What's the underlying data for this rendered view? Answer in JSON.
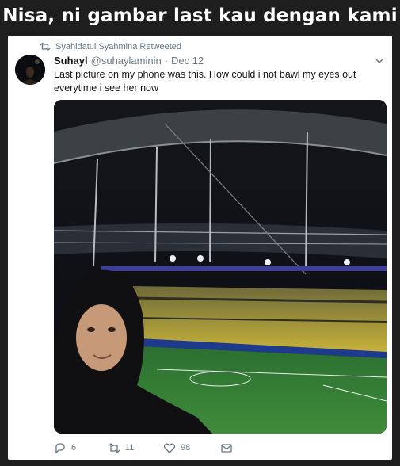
{
  "caption": "Nisa, ni gambar last kau dengan kami",
  "tweet": {
    "retweeted_by": "Syahidatul Syahmina Retweeted",
    "author_name": "Suhayl",
    "author_handle": "@suhaylaminin",
    "separator": "·",
    "date": "Dec 12",
    "text": "Last picture on my phone was this. How could i not bawl my eyes out everytime i see her now",
    "media_description": "Selfie of a woman in a black hijab inside a lit football stadium at night",
    "stats": {
      "replies": "6",
      "retweets": "11",
      "likes": "98"
    }
  },
  "icons": {
    "retweet_context": "retweet-icon",
    "caret": "chevron-down-icon",
    "reply": "reply-icon",
    "retweet": "retweet-icon",
    "like": "heart-icon",
    "message": "envelope-icon"
  },
  "colors": {
    "background": "#1e1e1e",
    "card": "#ffffff",
    "secondary_text": "#657786",
    "primary_text": "#14171a",
    "pitch": "#2f7a2f",
    "stands": "#c9b43a"
  }
}
